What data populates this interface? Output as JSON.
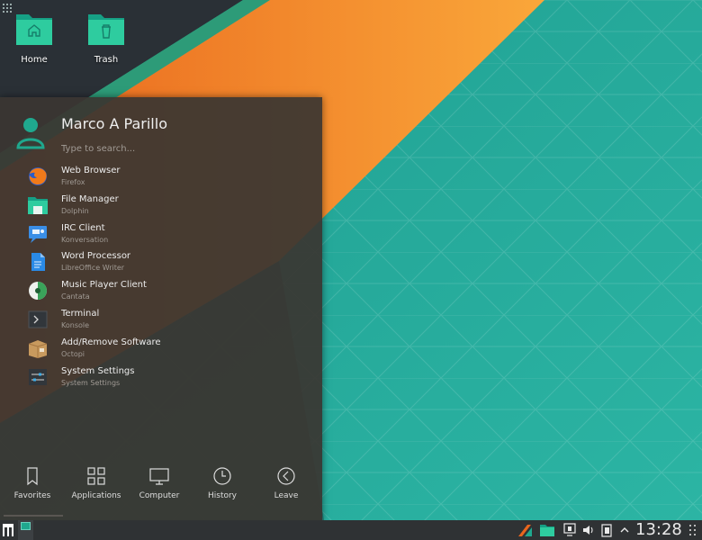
{
  "desktop": {
    "icons": [
      {
        "label": "Home"
      },
      {
        "label": "Trash"
      }
    ]
  },
  "launcher": {
    "user_name": "Marco A Parillo",
    "search_placeholder": "Type to search...",
    "favorites": [
      {
        "name": "Web Browser",
        "app": "Firefox",
        "icon": "firefox-icon"
      },
      {
        "name": "File Manager",
        "app": "Dolphin",
        "icon": "dolphin-icon"
      },
      {
        "name": "IRC Client",
        "app": "Konversation",
        "icon": "konversation-icon"
      },
      {
        "name": "Word Processor",
        "app": "LibreOffice Writer",
        "icon": "writer-icon"
      },
      {
        "name": "Music Player Client",
        "app": "Cantata",
        "icon": "cantata-icon"
      },
      {
        "name": "Terminal",
        "app": "Konsole",
        "icon": "konsole-icon"
      },
      {
        "name": "Add/Remove Software",
        "app": "Octopi",
        "icon": "octopi-icon"
      },
      {
        "name": "System Settings",
        "app": "System Settings",
        "icon": "settings-icon"
      }
    ],
    "tabs": [
      {
        "label": "Favorites",
        "icon": "bookmark-icon"
      },
      {
        "label": "Applications",
        "icon": "grid-icon"
      },
      {
        "label": "Computer",
        "icon": "monitor-icon"
      },
      {
        "label": "History",
        "icon": "clock-icon"
      },
      {
        "label": "Leave",
        "icon": "back-arrow-icon"
      }
    ]
  },
  "panel": {
    "clock": "13:28"
  },
  "colors": {
    "accent": "#1fa88e",
    "panel": "#2f3234",
    "launcher_bg": "#3a3632"
  }
}
